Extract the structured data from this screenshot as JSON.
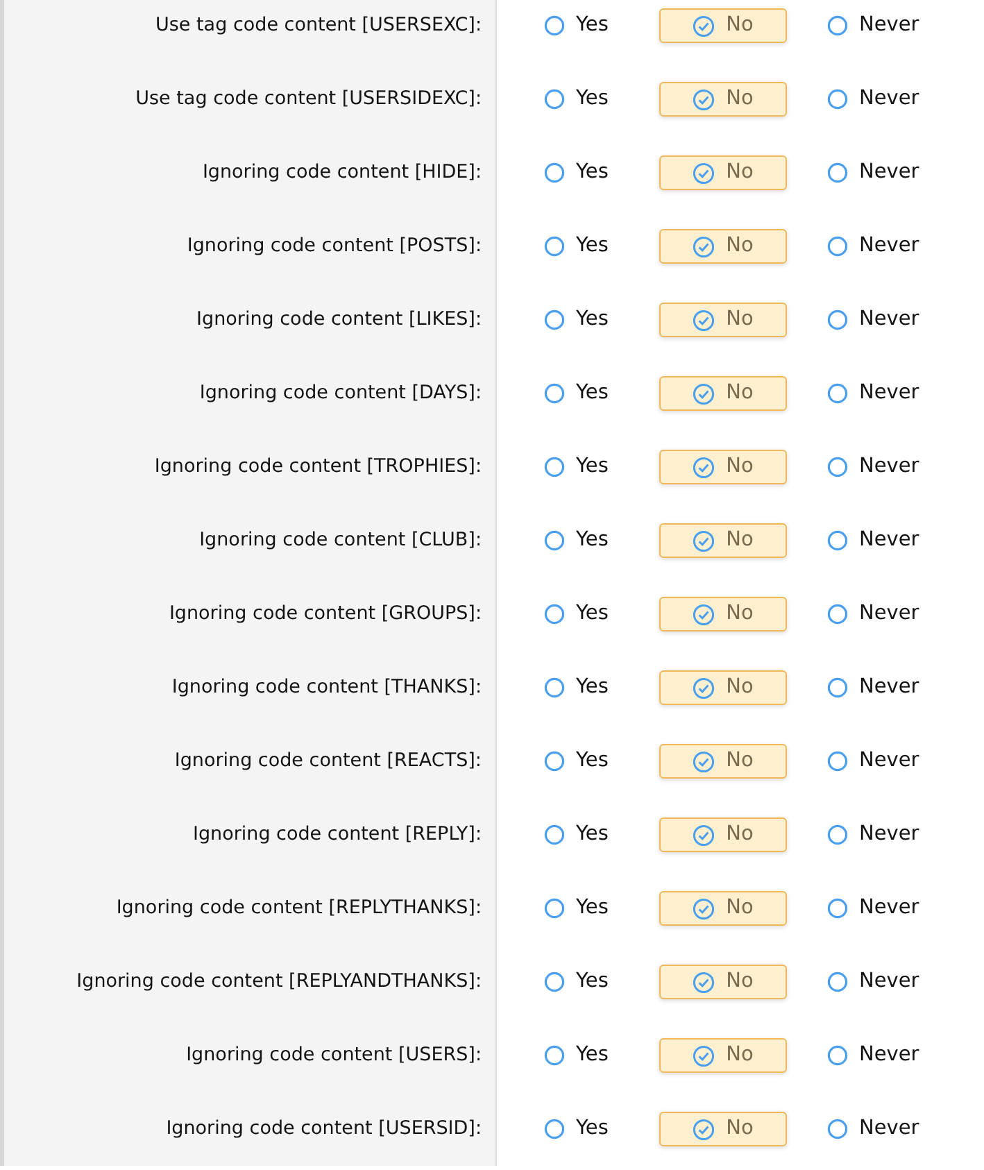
{
  "rows": [
    {
      "label": "Use tag code content [USERSEXC]:",
      "options": [
        {
          "label": "Yes",
          "selected": false
        },
        {
          "label": "No",
          "selected": true
        },
        {
          "label": "Never",
          "selected": false
        }
      ]
    },
    {
      "label": "Use tag code content [USERSIDEXC]:",
      "options": [
        {
          "label": "Yes",
          "selected": false
        },
        {
          "label": "No",
          "selected": true
        },
        {
          "label": "Never",
          "selected": false
        }
      ]
    },
    {
      "label": "Ignoring code content [HIDE]:",
      "options": [
        {
          "label": "Yes",
          "selected": false
        },
        {
          "label": "No",
          "selected": true
        },
        {
          "label": "Never",
          "selected": false
        }
      ]
    },
    {
      "label": "Ignoring code content [POSTS]:",
      "options": [
        {
          "label": "Yes",
          "selected": false
        },
        {
          "label": "No",
          "selected": true
        },
        {
          "label": "Never",
          "selected": false
        }
      ]
    },
    {
      "label": "Ignoring code content [LIKES]:",
      "options": [
        {
          "label": "Yes",
          "selected": false
        },
        {
          "label": "No",
          "selected": true
        },
        {
          "label": "Never",
          "selected": false
        }
      ]
    },
    {
      "label": "Ignoring code content [DAYS]:",
      "options": [
        {
          "label": "Yes",
          "selected": false
        },
        {
          "label": "No",
          "selected": true
        },
        {
          "label": "Never",
          "selected": false
        }
      ]
    },
    {
      "label": "Ignoring code content [TROPHIES]:",
      "options": [
        {
          "label": "Yes",
          "selected": false
        },
        {
          "label": "No",
          "selected": true
        },
        {
          "label": "Never",
          "selected": false
        }
      ]
    },
    {
      "label": "Ignoring code content [CLUB]:",
      "options": [
        {
          "label": "Yes",
          "selected": false
        },
        {
          "label": "No",
          "selected": true
        },
        {
          "label": "Never",
          "selected": false
        }
      ]
    },
    {
      "label": "Ignoring code content [GROUPS]:",
      "options": [
        {
          "label": "Yes",
          "selected": false
        },
        {
          "label": "No",
          "selected": true
        },
        {
          "label": "Never",
          "selected": false
        }
      ]
    },
    {
      "label": "Ignoring code content [THANKS]:",
      "options": [
        {
          "label": "Yes",
          "selected": false
        },
        {
          "label": "No",
          "selected": true
        },
        {
          "label": "Never",
          "selected": false
        }
      ]
    },
    {
      "label": "Ignoring code content [REACTS]:",
      "options": [
        {
          "label": "Yes",
          "selected": false
        },
        {
          "label": "No",
          "selected": true
        },
        {
          "label": "Never",
          "selected": false
        }
      ]
    },
    {
      "label": "Ignoring code content [REPLY]:",
      "options": [
        {
          "label": "Yes",
          "selected": false
        },
        {
          "label": "No",
          "selected": true
        },
        {
          "label": "Never",
          "selected": false
        }
      ]
    },
    {
      "label": "Ignoring code content [REPLYTHANKS]:",
      "options": [
        {
          "label": "Yes",
          "selected": false
        },
        {
          "label": "No",
          "selected": true
        },
        {
          "label": "Never",
          "selected": false
        }
      ]
    },
    {
      "label": "Ignoring code content [REPLYANDTHANKS]:",
      "options": [
        {
          "label": "Yes",
          "selected": false
        },
        {
          "label": "No",
          "selected": true
        },
        {
          "label": "Never",
          "selected": false
        }
      ]
    },
    {
      "label": "Ignoring code content [USERS]:",
      "options": [
        {
          "label": "Yes",
          "selected": false
        },
        {
          "label": "No",
          "selected": true
        },
        {
          "label": "Never",
          "selected": false
        }
      ]
    },
    {
      "label": "Ignoring code content [USERSID]:",
      "options": [
        {
          "label": "Yes",
          "selected": false
        },
        {
          "label": "No",
          "selected": true
        },
        {
          "label": "Never",
          "selected": false
        }
      ]
    }
  ]
}
